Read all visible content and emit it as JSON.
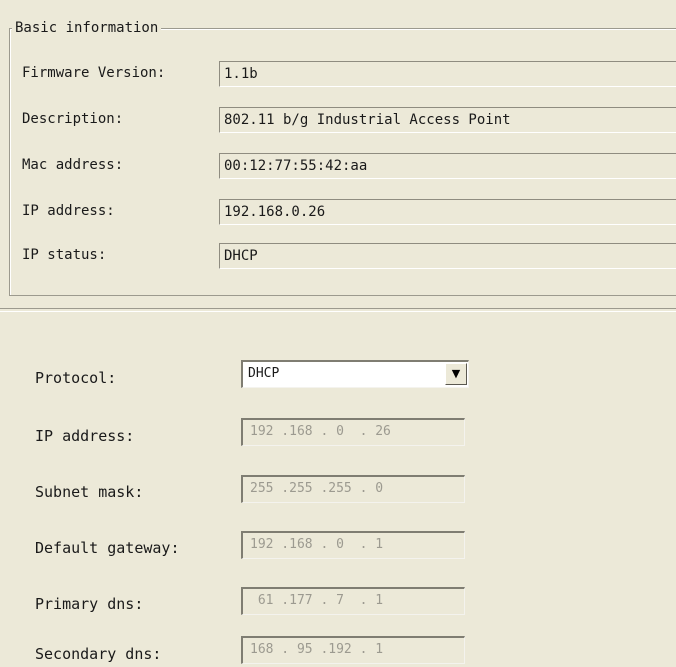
{
  "basic_info": {
    "title": "Basic information",
    "fields": [
      {
        "label": "Firmware Version:",
        "value": "1.1b"
      },
      {
        "label": "Description:",
        "value": "802.11 b/g Industrial Access Point"
      },
      {
        "label": "Mac address:",
        "value": "00:12:77:55:42:aa"
      },
      {
        "label": "IP address:",
        "value": "192.168.0.26"
      },
      {
        "label": "IP status:",
        "value": "DHCP"
      }
    ]
  },
  "network": {
    "protocol_label": "Protocol:",
    "protocol_value": "DHCP",
    "protocol_arrow": "▼",
    "fields": [
      {
        "label": "IP address:",
        "value": "192 .168 . 0  . 26"
      },
      {
        "label": "Subnet mask:",
        "value": "255 .255 .255 . 0"
      },
      {
        "label": "Default gateway:",
        "value": "192 .168 . 0  . 1"
      },
      {
        "label": "Primary dns:",
        "value": " 61 .177 . 7  . 1"
      },
      {
        "label": "Secondary dns:",
        "value": "168 . 95 .192 . 1"
      }
    ]
  },
  "colors": {
    "window_bg": "#ece9d8",
    "disabled_text": "#9c9a90",
    "input_bg": "#ffffff"
  },
  "icons": {
    "dropdown": "chevron-down-icon"
  }
}
